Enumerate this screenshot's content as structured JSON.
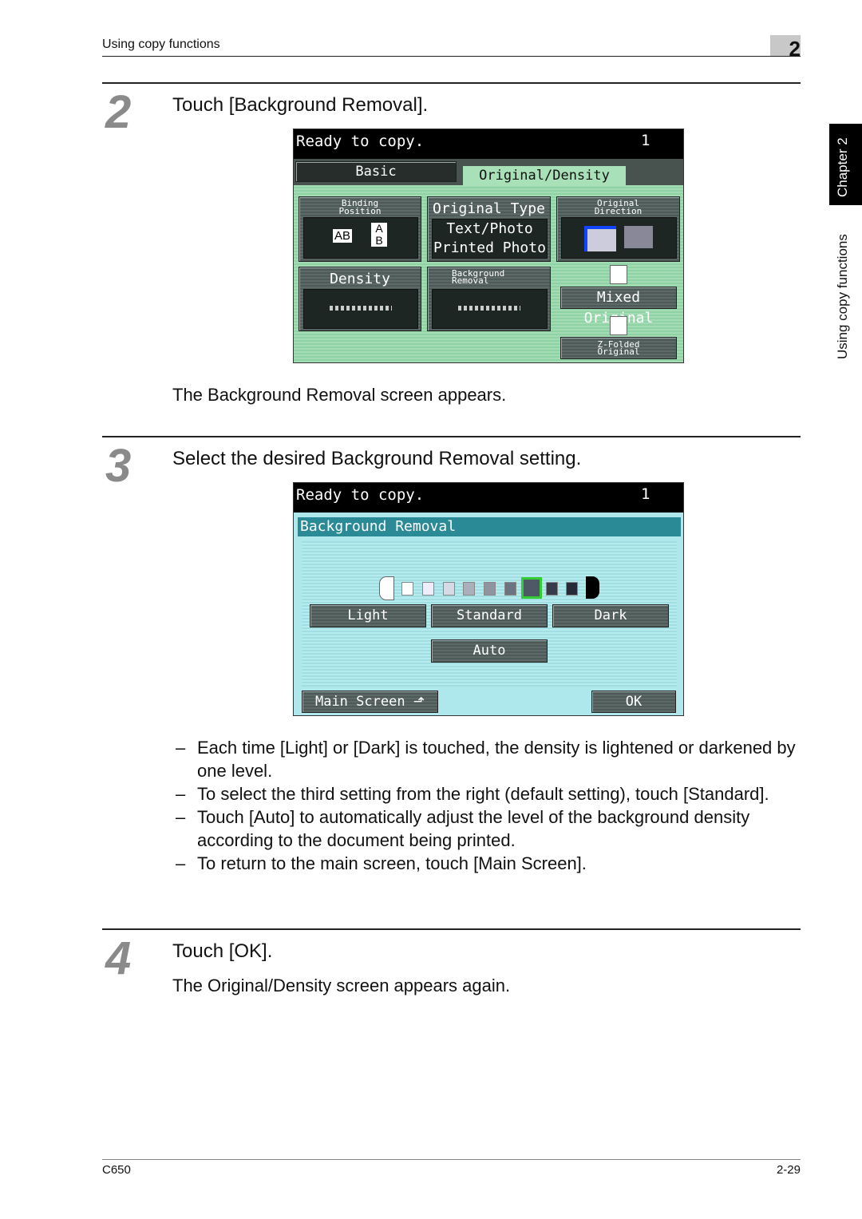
{
  "header": {
    "section": "Using copy functions",
    "chapter_number": "2"
  },
  "side_tab": {
    "chapter": "Chapter 2",
    "section": "Using copy functions"
  },
  "steps": [
    {
      "number": "2",
      "instruction": "Touch [Background Removal].",
      "result": "The Background Removal screen appears."
    },
    {
      "number": "3",
      "instruction": "Select the desired Background Removal setting.",
      "bullets": [
        "Each time [Light] or [Dark] is touched, the density is lightened or darkened by one level.",
        "To select the third setting from the right (default setting), touch [Standard].",
        "Touch [Auto] to automatically adjust the level of the background density according to the document being printed.",
        "To return to the main screen, touch [Main Screen]."
      ]
    },
    {
      "number": "4",
      "instruction": "Touch [OK].",
      "result": "The Original/Density screen appears again."
    }
  ],
  "bullet_dash": "–",
  "screen1": {
    "status": "Ready to copy.",
    "count": "1",
    "tabs": [
      "Basic",
      "Original/Density"
    ],
    "binding_position": "Binding Position",
    "original_type": "Original Type",
    "original_type_value1": "Text/Photo",
    "original_type_value2": "Printed Photo",
    "original_direction": "Original Direction",
    "density": "Density",
    "background_removal": "Background Removal",
    "mixed_original": "Mixed Original",
    "z_folded": "Z-Folded Original",
    "ab": "AB",
    "a": "A",
    "b": "B"
  },
  "screen2": {
    "status": "Ready to copy.",
    "count": "1",
    "title": "Background Removal",
    "levels": 9,
    "selected_level": 7,
    "light": "Light",
    "standard": "Standard",
    "dark": "Dark",
    "auto": "Auto",
    "main_screen": "Main Screen",
    "ok": "OK"
  },
  "colors": {
    "tab_active": "#a8e0b8",
    "panel_green": "#8fd3a4",
    "panel_cyan": "#aee8ec",
    "title_bar": "#2a8a96",
    "selected": "#33cc33"
  },
  "footer": {
    "model": "C650",
    "page": "2-29"
  }
}
